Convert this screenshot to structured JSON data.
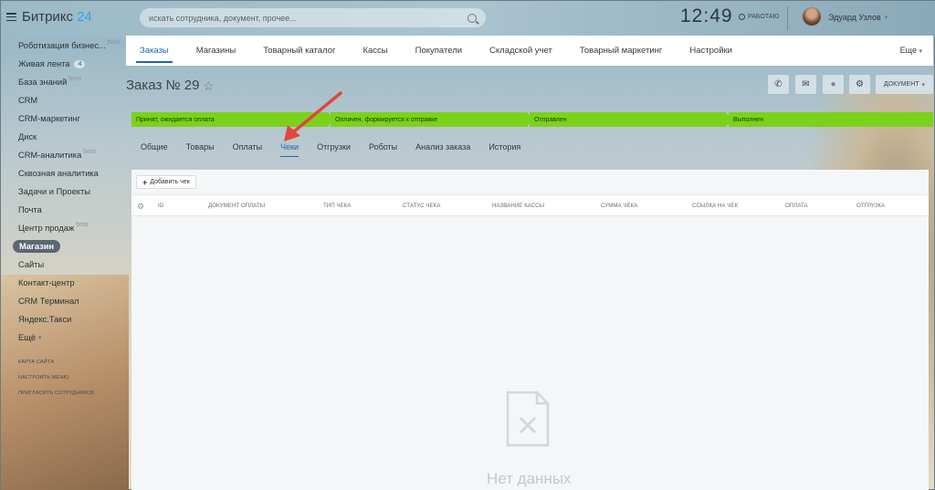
{
  "header": {
    "logo_main": "Битрикс",
    "logo_num": "24",
    "search_placeholder": "искать сотрудника, документ, прочее...",
    "clock": "12:49",
    "status": "РАБОТАЮ",
    "user_name": "Эдуард Узлов"
  },
  "sidebar": {
    "items": [
      {
        "label": "Роботизация бизнес...",
        "beta": "beta"
      },
      {
        "label": "Живая лента",
        "count": "4"
      },
      {
        "label": "База знаний",
        "beta": "beta"
      },
      {
        "label": "CRM"
      },
      {
        "label": "CRM-маркетинг"
      },
      {
        "label": "Диск"
      },
      {
        "label": "CRM-аналитика",
        "beta": "beta"
      },
      {
        "label": "Сквозная аналитика"
      },
      {
        "label": "Задачи и Проекты"
      },
      {
        "label": "Почта"
      },
      {
        "label": "Центр продаж",
        "beta": "beta"
      },
      {
        "label": "Магазин",
        "active": true
      },
      {
        "label": "Сайты"
      },
      {
        "label": "Контакт-центр"
      },
      {
        "label": "CRM Терминал"
      },
      {
        "label": "Яндекс.Такси"
      },
      {
        "label": "Ещё"
      }
    ],
    "small_links": [
      "КАРТА САЙТА",
      "НАСТРОИТЬ МЕНЮ",
      "ПРИГЛАСИТЬ СОТРУДНИКОВ"
    ]
  },
  "top_tabs": {
    "items": [
      "Заказы",
      "Магазины",
      "Товарный каталог",
      "Кассы",
      "Покупатели",
      "Складской учет",
      "Товарный маркетинг",
      "Настройки"
    ],
    "more": "Еще"
  },
  "order": {
    "title": "Заказ № 29",
    "document_button": "ДОКУМЕНТ"
  },
  "stages": [
    "Принят, ожидается оплата",
    "Оплачен, формируется к отправке",
    "Отправлен",
    "Выполнен"
  ],
  "subtabs": [
    "Общие",
    "Товары",
    "Оплаты",
    "Чеки",
    "Отгрузки",
    "Роботы",
    "Анализ заказа",
    "История"
  ],
  "grid": {
    "add_button": "Добавить чек",
    "columns": [
      "ID",
      "ДОКУМЕНТ ОПЛАТЫ",
      "ТИП ЧЕКА",
      "СТАТУС ЧЕКА",
      "НАЗВАНИЕ КАССЫ",
      "СУММА ЧЕКА",
      "ССЫЛКА НА ЧЕК",
      "ОПЛАТА",
      "ОТГРУЗКА"
    ],
    "empty_text": "Нет данных"
  },
  "colors": {
    "stage_green": "#7bd21a",
    "active_blue": "#2067b0",
    "logo_blue": "#2fa5df",
    "annotation_arrow": "#e2453c"
  }
}
